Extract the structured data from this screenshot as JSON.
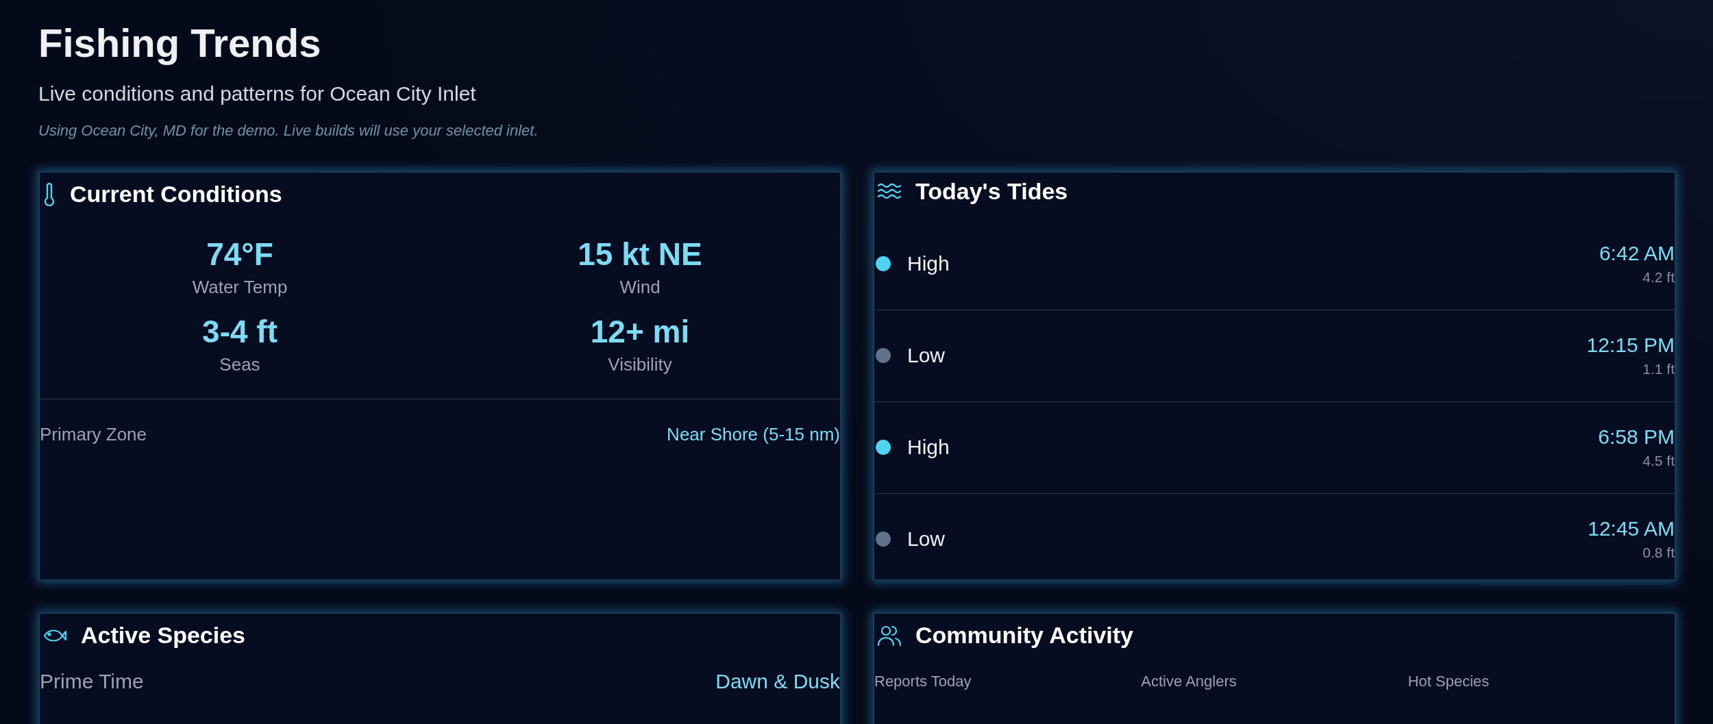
{
  "header": {
    "title": "Fishing Trends",
    "subtitle": "Live conditions and patterns for Ocean City Inlet",
    "note": "Using Ocean City, MD for the demo. Live builds will use your selected inlet."
  },
  "conditions": {
    "title": "Current Conditions",
    "stats": [
      {
        "value": "74°F",
        "label": "Water Temp"
      },
      {
        "value": "15 kt NE",
        "label": "Wind"
      },
      {
        "value": "3-4 ft",
        "label": "Seas"
      },
      {
        "value": "12+ mi",
        "label": "Visibility"
      }
    ],
    "zone": {
      "label": "Primary Zone",
      "value": "Near Shore (5-15 nm)"
    }
  },
  "tides": {
    "title": "Today's Tides",
    "rows": [
      {
        "label": "High",
        "time": "6:42 AM",
        "height": "4.2 ft",
        "color": "#4fd3f2"
      },
      {
        "label": "Low",
        "time": "12:15 PM",
        "height": "1.1 ft",
        "color": "#5f7289"
      },
      {
        "label": "High",
        "time": "6:58 PM",
        "height": "4.5 ft",
        "color": "#4fd3f2"
      },
      {
        "label": "Low",
        "time": "12:45 AM",
        "height": "0.8 ft",
        "color": "#5f7289"
      }
    ]
  },
  "species": {
    "title": "Active Species",
    "prime": {
      "label": "Prime Time",
      "value": "Dawn & Dusk"
    }
  },
  "community": {
    "title": "Community Activity",
    "stats": [
      {
        "label": "Reports Today"
      },
      {
        "label": "Active Anglers"
      },
      {
        "label": "Hot Species"
      }
    ]
  }
}
